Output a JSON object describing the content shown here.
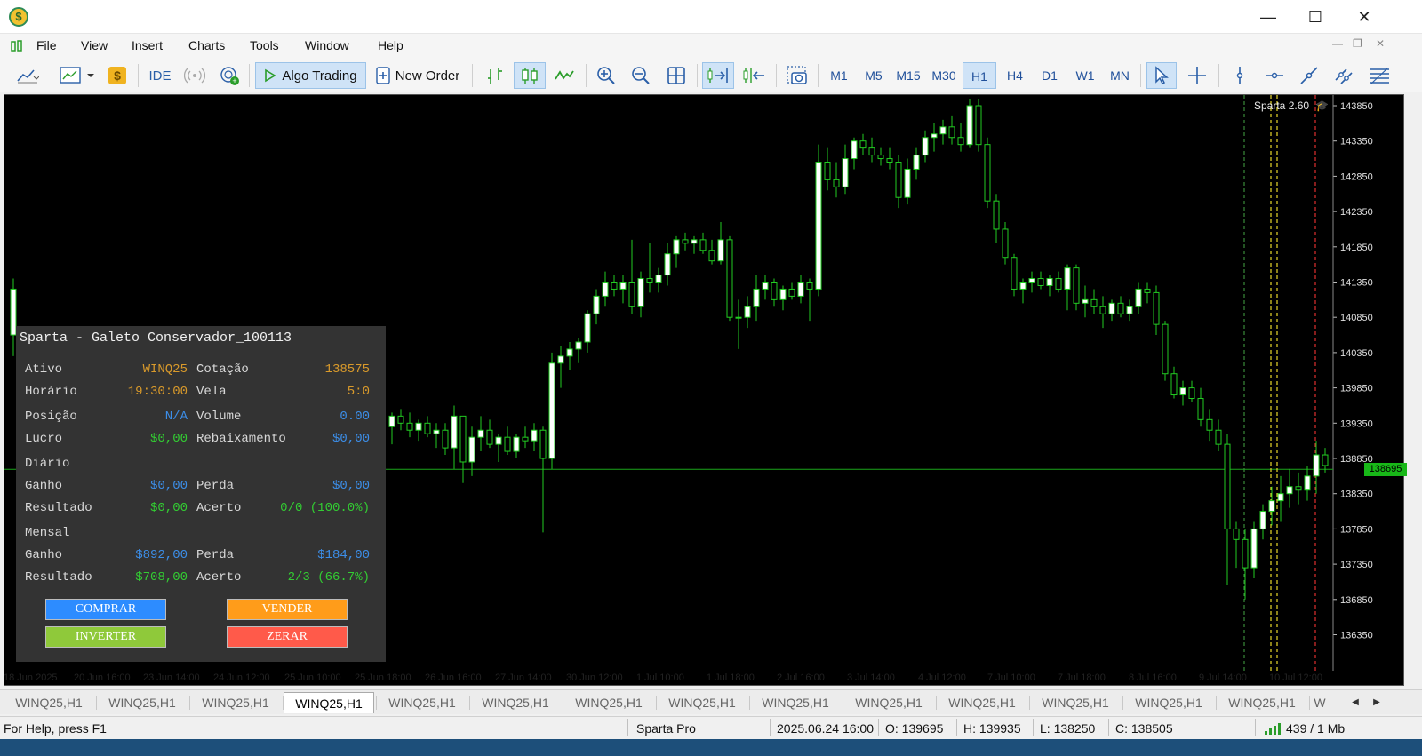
{
  "window": {
    "minimize": "—",
    "maximize": "☐",
    "close": "✕"
  },
  "menu": [
    "File",
    "View",
    "Insert",
    "Charts",
    "Tools",
    "Window",
    "Help"
  ],
  "toolbar": {
    "ide_label": "IDE",
    "algo_trading_label": "Algo Trading",
    "new_order_label": "New Order",
    "timeframes": [
      "M1",
      "M5",
      "M15",
      "M30",
      "H1",
      "H4",
      "D1",
      "W1",
      "MN"
    ],
    "active_timeframe": "H1"
  },
  "chart": {
    "indicator_label": "Sparta 2.60",
    "current_price_label": "138695",
    "price_axis": [
      "143850",
      "143350",
      "142850",
      "142350",
      "141850",
      "141350",
      "140850",
      "140350",
      "139850",
      "139350",
      "138850",
      "138350",
      "137850",
      "137350",
      "136850",
      "136350"
    ],
    "time_axis": [
      "18 Jun 2025",
      "20 Jun 16:00",
      "23 Jun 14:00",
      "24 Jun 12:00",
      "25 Jun 10:00",
      "25 Jun 18:00",
      "26 Jun 16:00",
      "27 Jun 14:00",
      "30 Jun 12:00",
      "1 Jul 10:00",
      "1 Jul 18:00",
      "2 Jul 16:00",
      "3 Jul 14:00",
      "4 Jul 12:00",
      "7 Jul 10:00",
      "7 Jul 18:00",
      "8 Jul 16:00",
      "9 Jul 14:00",
      "10 Jul 12:00"
    ],
    "colors": {
      "background": "#000000",
      "bull": "#ffffff",
      "bear": "#000000",
      "wick": "#22cc22",
      "bid_line": "#1aa51a"
    }
  },
  "panel": {
    "title": "Sparta - Galeto Conservador_100113",
    "ativo_label": "Ativo",
    "ativo_value": "WINQ25",
    "cotacao_label": "Cotação",
    "cotacao_value": "138575",
    "horario_label": "Horário",
    "horario_value": "19:30:00",
    "vela_label": "Vela",
    "vela_value": "5:0",
    "posicao_label": "Posição",
    "posicao_value": "N/A",
    "volume_label": "Volume",
    "volume_value": "0.00",
    "lucro_label": "Lucro",
    "lucro_value": "$0,00",
    "rebaixamento_label": "Rebaixamento",
    "rebaixamento_value": "$0,00",
    "diario_label": "Diário",
    "d_ganho_label": "Ganho",
    "d_ganho_value": "$0,00",
    "d_perda_label": "Perda",
    "d_perda_value": "$0,00",
    "d_resultado_label": "Resultado",
    "d_resultado_value": "$0,00",
    "d_acerto_label": "Acerto",
    "d_acerto_value": "0/0 (100.0%)",
    "mensal_label": "Mensal",
    "m_ganho_label": "Ganho",
    "m_ganho_value": "$892,00",
    "m_perda_label": "Perda",
    "m_perda_value": "$184,00",
    "m_resultado_label": "Resultado",
    "m_resultado_value": "$708,00",
    "m_acerto_label": "Acerto",
    "m_acerto_value": "2/3 (66.7%)",
    "btn_comprar": "COMPRAR",
    "btn_vender": "VENDER",
    "btn_inverter": "INVERTER",
    "btn_zerar": "ZERAR",
    "colors": {
      "orange": "#d99a2b",
      "blue": "#3c8ee8",
      "green": "#33cc33",
      "comprar": "#2d8cff",
      "vender": "#ff9c1a",
      "inverter": "#8fc93a",
      "zerar": "#ff5a4a"
    }
  },
  "tabs": [
    "WINQ25,H1",
    "WINQ25,H1",
    "WINQ25,H1",
    "WINQ25,H1",
    "WINQ25,H1",
    "WINQ25,H1",
    "WINQ25,H1",
    "WINQ25,H1",
    "WINQ25,H1",
    "WINQ25,H1",
    "WINQ25,H1",
    "WINQ25,H1",
    "WINQ25,H1",
    "WINQ25,H1",
    "W"
  ],
  "active_tab_index": 3,
  "status": {
    "help": "For Help, press F1",
    "profile": "Sparta Pro",
    "datetime": "2025.06.24 16:00",
    "open": "O: 139695",
    "high": "H: 139935",
    "low": "L: 138250",
    "close": "C: 138505",
    "traffic": "439 / 1 Mb"
  }
}
